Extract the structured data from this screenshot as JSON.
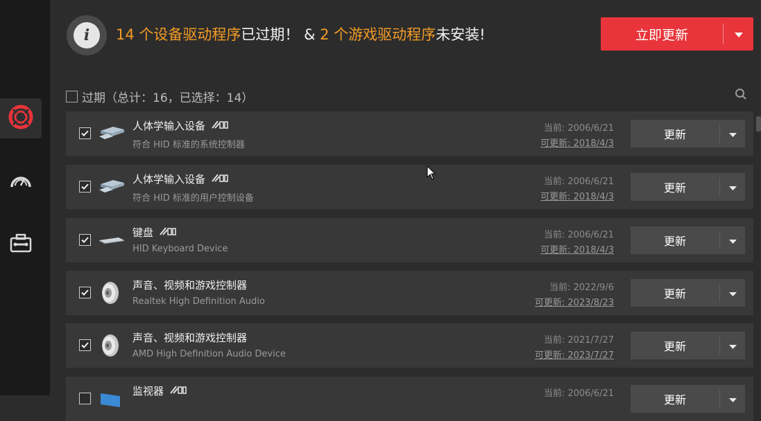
{
  "sidebar": {
    "items": [
      {
        "name": "driver-update",
        "icon": "lifebuoy-icon",
        "active": true
      },
      {
        "name": "boost",
        "icon": "speedometer-icon",
        "active": false
      },
      {
        "name": "toolbox",
        "icon": "toolbox-icon",
        "active": false
      }
    ]
  },
  "banner": {
    "count1": "14 个设备驱动程序",
    "text1": "已过期！ & ",
    "count2": "2 个游戏驱动程序",
    "text2": "未安装!",
    "update_all_label": "立即更新"
  },
  "filter": {
    "label": "过期（总计：16，已选择：14）"
  },
  "rows": [
    {
      "name": "人体学输入设备",
      "sub": "符合 HID 标准的系统控制器",
      "current": "当前: 2006/6/21",
      "available": "可更新: 2018/4/3",
      "button": "更新",
      "checked": true,
      "icon": "input-device-icon"
    },
    {
      "name": "人体学输入设备",
      "sub": "符合 HID 标准的用户控制设备",
      "current": "当前: 2006/6/21",
      "available": "可更新: 2018/4/3",
      "button": "更新",
      "checked": true,
      "icon": "input-device-icon"
    },
    {
      "name": "键盘",
      "sub": "HID Keyboard Device",
      "current": "当前: 2006/6/21",
      "available": "可更新: 2018/4/3",
      "button": "更新",
      "checked": true,
      "icon": "keyboard-icon"
    },
    {
      "name": "声音、视频和游戏控制器",
      "sub": "Realtek High Definition Audio",
      "current": "当前: 2022/9/6",
      "available": "可更新: 2023/8/23",
      "button": "更新",
      "checked": true,
      "icon": "speaker-icon"
    },
    {
      "name": "声音、视频和游戏控制器",
      "sub": "AMD High Definition Audio Device",
      "current": "当前: 2021/7/27",
      "available": "可更新: 2023/7/27",
      "button": "更新",
      "checked": true,
      "icon": "speaker-icon"
    },
    {
      "name": "监视器",
      "sub": "",
      "current": "当前: 2006/6/21",
      "available": "",
      "button": "更新",
      "checked": false,
      "icon": "monitor-icon"
    }
  ],
  "colors": {
    "accent_red": "#e8343a",
    "orange": "#f29b26"
  }
}
